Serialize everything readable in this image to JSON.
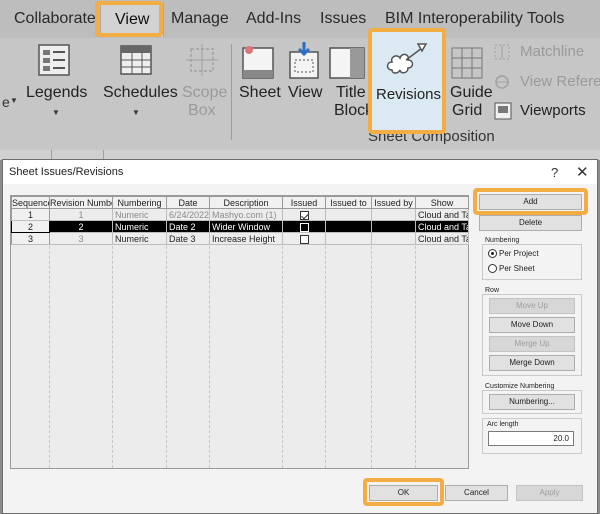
{
  "ribbon": {
    "tabs": [
      "Collaborate",
      "View",
      "Manage",
      "Add-Ins",
      "Issues",
      "BIM Interoperability Tools"
    ],
    "active_tab": "View",
    "tools": {
      "legends": "Legends",
      "schedules": "Schedules",
      "scope_box_line1": "Scope",
      "scope_box_line2": "Box",
      "sheet": "Sheet",
      "view": "View",
      "title_block_line1": "Title",
      "title_block_line2": "Block",
      "revisions": "Revisions",
      "guide_grid_line1": "Guide",
      "guide_grid_line2": "Grid",
      "matchline": "Matchline",
      "view_reference": "View Refere",
      "viewports": "Viewports"
    },
    "panel_label": "Sheet Composition",
    "accent_color": "#f2ad45"
  },
  "dialog": {
    "title": "Sheet Issues/Revisions",
    "help_label": "?",
    "close_label": "✕",
    "columns": [
      "Sequence",
      "Revision Number",
      "Numbering",
      "Date",
      "Description",
      "Issued",
      "Issued to",
      "Issued by",
      "Show"
    ],
    "rows": [
      {
        "sequence": "1",
        "revision_number": "1",
        "numbering": "Numeric",
        "date": "6/24/2022",
        "description": "Mashyo.com (1)",
        "issued": true,
        "issued_to": "",
        "issued_by": "",
        "show": "Cloud and Tag"
      },
      {
        "sequence": "2",
        "revision_number": "2",
        "numbering": "Numeric",
        "date": "Date 2",
        "description": "Wider Window",
        "issued": false,
        "issued_to": "",
        "issued_by": "",
        "show": "Cloud and Tag"
      },
      {
        "sequence": "3",
        "revision_number": "3",
        "numbering": "Numeric",
        "date": "Date 3",
        "description": "Increase Height",
        "issued": false,
        "issued_to": "",
        "issued_by": "",
        "show": "Cloud and Tag"
      }
    ],
    "buttons": {
      "add": "Add",
      "delete": "Delete",
      "move_up": "Move Up",
      "move_down": "Move Down",
      "merge_up": "Merge Up",
      "merge_down": "Merge Down",
      "numbering_settings": "Numbering...",
      "ok": "OK",
      "cancel": "Cancel",
      "apply": "Apply"
    },
    "numbering": {
      "label": "Numbering",
      "per_project": "Per Project",
      "per_sheet": "Per Sheet",
      "selected": "Per Project"
    },
    "row_group_label": "Row",
    "customize_label": "Customize Numbering",
    "arc_length": {
      "label": "Arc length",
      "value": "20.0"
    }
  }
}
